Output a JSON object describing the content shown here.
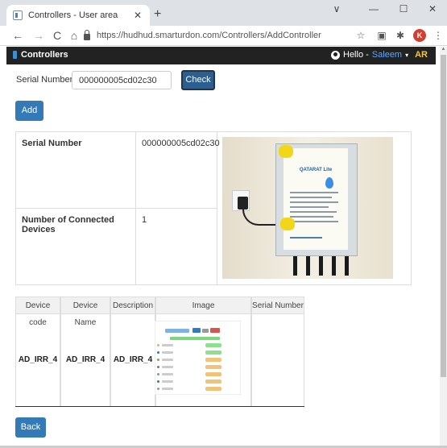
{
  "browser": {
    "tab_title": "Controllers - User area",
    "tab_close": "✕",
    "new_tab": "+",
    "url": "https://hudhud.smarturdon.com/Controllers/AddController",
    "profile_initial": "K",
    "icons": {
      "back": "←",
      "forward": "→",
      "reload": "C",
      "home": "⌂",
      "star": "☆",
      "extensions": "✱",
      "menu": "⋮",
      "minimize": "—",
      "maximize": "☐",
      "close": "✕",
      "tab_search": "∨"
    }
  },
  "navbar": {
    "brand": "Controllers",
    "greeting": "Hello - ",
    "username": "Saleem",
    "caret": "▾",
    "language": "AR"
  },
  "form": {
    "serial_label": "Serial Number",
    "serial_value": "000000005cd02c30",
    "check_label": "Check",
    "add_label": "Add"
  },
  "details": {
    "serial_label": "Serial Number",
    "serial_value": "000000005cd02c30",
    "devices_label": "Number of Connected Devices",
    "devices_value": "1",
    "photo_sticker_title": "QATARAT Lite"
  },
  "devices_table": {
    "headers": [
      "Device code",
      "Device Name",
      "Description",
      "Image",
      "Serial Number"
    ],
    "rows": [
      {
        "code": "AD_IRR_4",
        "name": "AD_IRR_4",
        "description": "AD_IRR_4",
        "serial": ""
      }
    ]
  },
  "back_label": "Back",
  "colors": {
    "primary_button": "#337ab7",
    "check_button": "#2c5f8f",
    "navbar_bg": "#222222",
    "username": "#5aa8ff",
    "language": "#f5c542"
  }
}
